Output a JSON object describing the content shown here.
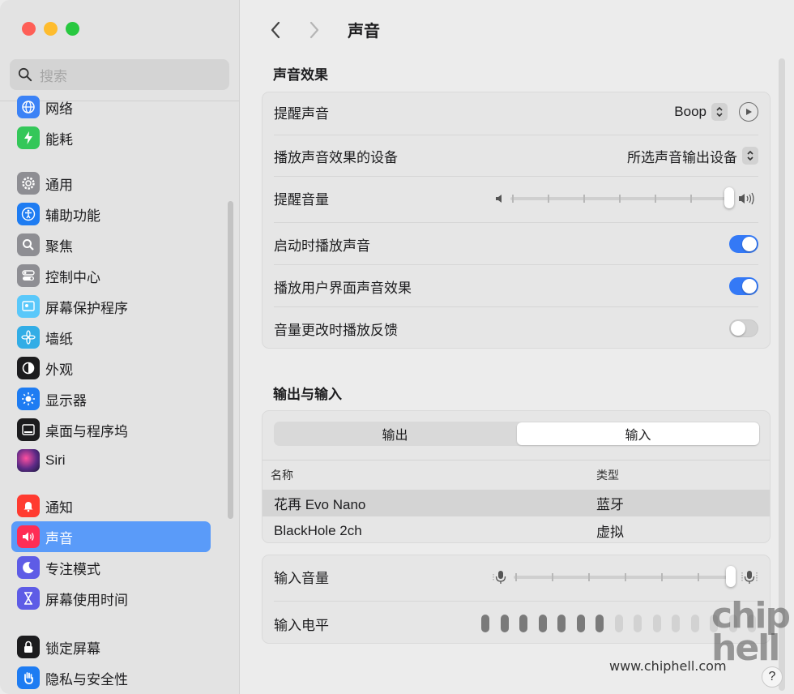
{
  "sidebar": {
    "search_placeholder": "搜索",
    "items": [
      {
        "label": "网络",
        "icon": "globe-icon",
        "color": "#3b82f6"
      },
      {
        "label": "能耗",
        "icon": "battery-bolt-icon",
        "color": "#34c759"
      },
      {
        "label": "通用",
        "icon": "gear-icon",
        "color": "#8e8e93"
      },
      {
        "label": "辅助功能",
        "icon": "accessibility-icon",
        "color": "#1e7cf2"
      },
      {
        "label": "聚焦",
        "icon": "magnifier-icon",
        "color": "#8e8e93"
      },
      {
        "label": "控制中心",
        "icon": "control-center-icon",
        "color": "#8e8e93"
      },
      {
        "label": "屏幕保护程序",
        "icon": "screensaver-icon",
        "color": "#5ac8fa"
      },
      {
        "label": "墙纸",
        "icon": "flower-icon",
        "color": "#32ade6"
      },
      {
        "label": "外观",
        "icon": "appearance-icon",
        "color": "#1c1c1e"
      },
      {
        "label": "显示器",
        "icon": "sun-icon",
        "color": "#1e7cf2"
      },
      {
        "label": "桌面与程序坞",
        "icon": "dock-icon",
        "color": "#1c1c1e"
      },
      {
        "label": "Siri",
        "icon": "siri-icon",
        "color": "#5b2a86"
      },
      {
        "label": "通知",
        "icon": "bell-icon",
        "color": "#ff3b30"
      },
      {
        "label": "声音",
        "icon": "speaker-icon",
        "color": "#ff2d55"
      },
      {
        "label": "专注模式",
        "icon": "moon-icon",
        "color": "#5e5ce6"
      },
      {
        "label": "屏幕使用时间",
        "icon": "hourglass-icon",
        "color": "#5e5ce6"
      },
      {
        "label": "锁定屏幕",
        "icon": "lock-icon",
        "color": "#1c1c1e"
      },
      {
        "label": "隐私与安全性",
        "icon": "hand-icon",
        "color": "#1e7cf2"
      }
    ],
    "active": "声音"
  },
  "header": {
    "title": "声音"
  },
  "sound_effects": {
    "heading": "声音效果",
    "alert_sound_label": "提醒声音",
    "alert_sound_value": "Boop",
    "device_label": "播放声音效果的设备",
    "device_value": "所选声音输出设备",
    "alert_volume_label": "提醒音量",
    "alert_volume_level": 1.0,
    "startup_label": "启动时播放声音",
    "startup_on": true,
    "ui_effects_label": "播放用户界面声音效果",
    "ui_effects_on": true,
    "feedback_label": "音量更改时播放反馈",
    "feedback_on": false
  },
  "io": {
    "heading": "输出与输入",
    "tabs": [
      "输出",
      "输入"
    ],
    "selected_tab": "输入",
    "columns": [
      "名称",
      "类型"
    ],
    "rows": [
      {
        "name": "花再 Evo Nano",
        "type": "蓝牙"
      },
      {
        "name": "BlackHole 2ch",
        "type": "虚拟"
      }
    ],
    "input_volume_label": "输入音量",
    "input_volume_level": 1.0,
    "input_level_label": "输入电平",
    "input_level_active": 7,
    "input_level_total": 15
  },
  "watermark": "www.chiphell.com",
  "watermark_logo": "chip hell",
  "colors": {
    "accent": "#3479f6",
    "selection": "#5a9bf9"
  }
}
